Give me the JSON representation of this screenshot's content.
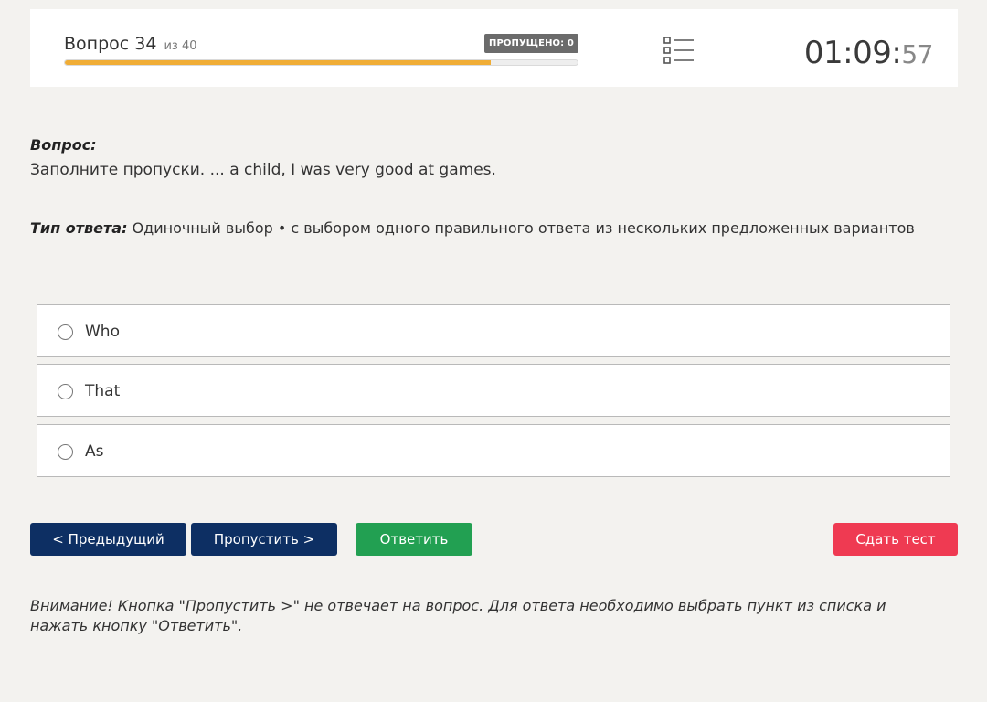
{
  "header": {
    "question_label": "Вопрос 34",
    "question_of": "из 40",
    "skipped_badge": "ПРОПУЩЕНО: 0",
    "progress_fraction": 0.83,
    "timer_main": "01:09:",
    "timer_seconds": "57",
    "list_icon": "list-icon"
  },
  "question": {
    "label": "Вопрос:",
    "text": "Заполните пропуски. ... a child, I was very good at games."
  },
  "answer_type": {
    "label": "Тип ответа:",
    "value": "Одиночный выбор • с выбором одного правильного ответа из нескольких предложенных вариантов"
  },
  "options": [
    {
      "label": "Who"
    },
    {
      "label": "That"
    },
    {
      "label": "As"
    }
  ],
  "buttons": {
    "prev": "< Предыдущий",
    "skip": "Пропустить >",
    "answer": "Ответить",
    "submit": "Сдать тест"
  },
  "warning": "Внимание! Кнопка \"Пропустить >\" не отвечает на вопрос. Для ответа необходимо выбрать пункт из списка и нажать кнопку \"Ответить\".",
  "colors": {
    "progress": "#f0ad36",
    "primary_button": "#0d2f63",
    "answer_button": "#22a052",
    "submit_button": "#ef3a52",
    "badge": "#6b6b6b"
  }
}
